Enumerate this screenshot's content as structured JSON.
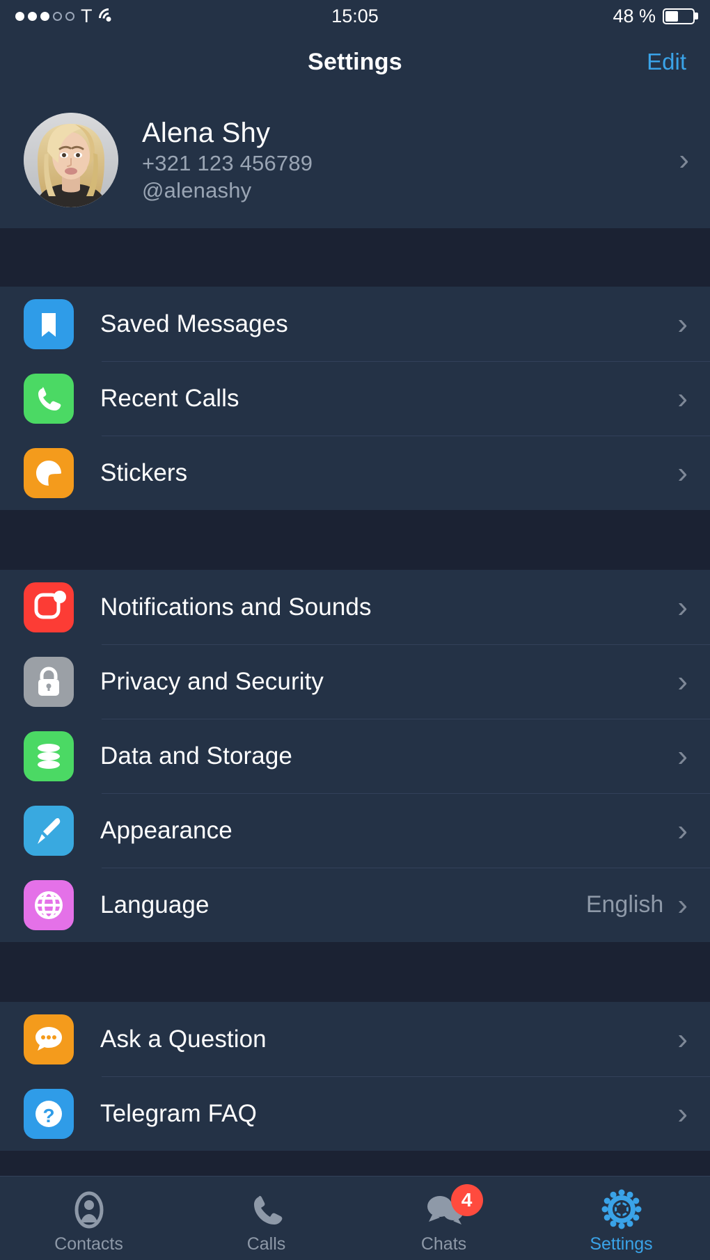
{
  "status_bar": {
    "signal_dots_filled": 3,
    "signal_dots_total": 5,
    "carrier": "T",
    "wifi_icon": "wifi-icon",
    "time": "15:05",
    "battery_percent": "48 %",
    "battery_level": 48
  },
  "navbar": {
    "title": "Settings",
    "edit_label": "Edit",
    "accent_color": "#3aa3e8"
  },
  "profile": {
    "name": "Alena Shy",
    "phone": "+321 123 456789",
    "username": "@alenashy",
    "avatar_icon": "user-avatar-photo",
    "chevron": "›"
  },
  "groups": [
    {
      "rows": [
        {
          "label": "Saved Messages",
          "icon": "bookmark-icon",
          "icon_color": "#2f9ce8",
          "detail": "",
          "chevron": "›"
        },
        {
          "label": "Recent Calls",
          "icon": "phone-icon",
          "icon_color": "#4bd964",
          "detail": "",
          "chevron": "›"
        },
        {
          "label": "Stickers",
          "icon": "sticker-icon",
          "icon_color": "#f49b1c",
          "detail": "",
          "chevron": "›"
        }
      ]
    },
    {
      "rows": [
        {
          "label": "Notifications and Sounds",
          "icon": "notification-bell-icon",
          "icon_color": "#fc3c35",
          "detail": "",
          "chevron": "›"
        },
        {
          "label": "Privacy and Security",
          "icon": "lock-icon",
          "icon_color": "#9ba0a6",
          "detail": "",
          "chevron": "›"
        },
        {
          "label": "Data and Storage",
          "icon": "database-icon",
          "icon_color": "#4bd964",
          "detail": "",
          "chevron": "›"
        },
        {
          "label": "Appearance",
          "icon": "paintbrush-icon",
          "icon_color": "#39a9e0",
          "detail": "",
          "chevron": "›"
        },
        {
          "label": "Language",
          "icon": "globe-icon",
          "icon_color": "#e471e8",
          "detail": "English",
          "chevron": "›"
        }
      ]
    },
    {
      "rows": [
        {
          "label": "Ask a Question",
          "icon": "chat-bubble-icon",
          "icon_color": "#f49b1c",
          "detail": "",
          "chevron": "›"
        },
        {
          "label": "Telegram FAQ",
          "icon": "question-mark-icon",
          "icon_color": "#2f9ce8",
          "detail": "",
          "chevron": "›"
        }
      ]
    }
  ],
  "tabbar": {
    "tabs": [
      {
        "label": "Contacts",
        "icon": "contacts-icon",
        "active": false,
        "badge": ""
      },
      {
        "label": "Calls",
        "icon": "calls-icon",
        "active": false,
        "badge": ""
      },
      {
        "label": "Chats",
        "icon": "chats-icon",
        "active": true,
        "badge": "4"
      },
      {
        "label": "Settings",
        "icon": "gear-icon",
        "active": false,
        "badge": ""
      }
    ],
    "active_index": 3,
    "active_color": "#3aa3e8",
    "inactive_color": "#8e99a8",
    "badge_color": "#ff4b3e"
  },
  "colors": {
    "row_background": "#243246",
    "page_background": "#1b2233",
    "separator": "#33415a",
    "primary_text": "#ffffff",
    "secondary_text": "#8e99a8"
  }
}
